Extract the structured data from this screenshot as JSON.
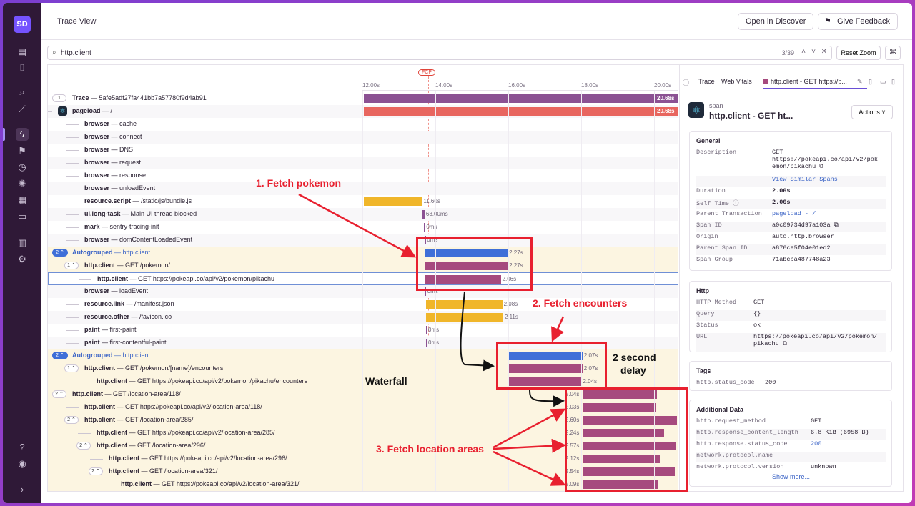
{
  "sidebar": {
    "avatar": "SD"
  },
  "header": {
    "title": "Trace View",
    "open_discover": "Open in Discover",
    "give_feedback": "Give Feedback"
  },
  "search": {
    "value": "http.client",
    "count": "3/39",
    "reset_zoom": "Reset Zoom",
    "shortcut": "⌘"
  },
  "timeline": {
    "ticks": [
      "12.00s",
      "14.00s",
      "16.00s",
      "18.00s",
      "20.00s"
    ],
    "fcp": "FCP"
  },
  "colors": {
    "purple": "#8b5193",
    "red": "#e8665f",
    "yellow": "#f0b62a",
    "blue": "#3f6fd8",
    "magenta": "#a64a7e",
    "annotation": "#e8202f"
  },
  "rows": [
    {
      "indent": 0,
      "badge": "1",
      "op": "Trace",
      "desc": "5afe5adf27fa441bb7a57780f9d4ab91",
      "bar": [
        0.0,
        1.0
      ],
      "color": "purple",
      "dur": "20.68s"
    },
    {
      "indent": 0,
      "icon": true,
      "op": "pageload",
      "desc": "/",
      "bar": [
        0.0,
        1.0
      ],
      "color": "red",
      "dur": "20.68s"
    },
    {
      "indent": 1,
      "op": "browser",
      "desc": "cache"
    },
    {
      "indent": 1,
      "op": "browser",
      "desc": "connect"
    },
    {
      "indent": 1,
      "op": "browser",
      "desc": "DNS"
    },
    {
      "indent": 1,
      "op": "browser",
      "desc": "request"
    },
    {
      "indent": 1,
      "op": "browser",
      "desc": "response"
    },
    {
      "indent": 1,
      "op": "browser",
      "desc": "unloadEvent"
    },
    {
      "indent": 1,
      "op": "resource.script",
      "desc": "/static/js/bundle.js",
      "bar": [
        0.0,
        0.185
      ],
      "color": "yellow",
      "dur": "11.60s"
    },
    {
      "indent": 1,
      "op": "ui.long-task",
      "desc": "Main UI thread blocked",
      "bar": [
        0.186,
        0.193
      ],
      "color": "purple",
      "dur": "63.00ms"
    },
    {
      "indent": 1,
      "op": "mark",
      "desc": "sentry-tracing-init",
      "bar": [
        0.192,
        0.194
      ],
      "color": "purple",
      "dur": "0ms"
    },
    {
      "indent": 1,
      "op": "browser",
      "desc": "domContentLoadedEvent",
      "bar": [
        0.194,
        0.196
      ],
      "color": "purple",
      "dur": "0ms"
    },
    {
      "indent": 0,
      "badge": "2",
      "badgeBlue": true,
      "group": true,
      "autogroup": true,
      "op": "Autogrouped",
      "desc": "http.client",
      "bar": [
        0.194,
        0.457
      ],
      "color": "blue",
      "dur": "2.27s"
    },
    {
      "indent": 1,
      "badge": "1",
      "group": true,
      "op": "http.client",
      "desc": "GET /pokemon/",
      "bar": [
        0.194,
        0.457
      ],
      "color": "magenta",
      "dur": "2.27s"
    },
    {
      "indent": 2,
      "group": true,
      "selected": true,
      "op": "http.client",
      "desc": "GET https://pokeapi.co/api/v2/pokemon/pikachu",
      "bar": [
        0.194,
        0.433
      ],
      "color": "magenta",
      "dur": "2.06s"
    },
    {
      "indent": 1,
      "op": "browser",
      "desc": "loadEvent",
      "bar": [
        0.194,
        0.197
      ],
      "color": "purple",
      "dur": "0ms"
    },
    {
      "indent": 1,
      "op": "resource.link",
      "desc": "/manifest.json",
      "bar": [
        0.197,
        0.44
      ],
      "color": "yellow",
      "dur": "2.08s"
    },
    {
      "indent": 1,
      "op": "resource.other",
      "desc": "/favicon.ico",
      "bar": [
        0.197,
        0.443
      ],
      "color": "yellow",
      "dur": "2.11s"
    },
    {
      "indent": 1,
      "op": "paint",
      "desc": "first-paint",
      "bar": [
        0.198,
        0.2
      ],
      "color": "purple",
      "dur": "0ms"
    },
    {
      "indent": 1,
      "op": "paint",
      "desc": "first-contentful-paint",
      "bar": [
        0.198,
        0.2
      ],
      "color": "purple",
      "dur": "0ms"
    },
    {
      "indent": 0,
      "badge": "2",
      "badgeBlue": true,
      "group": true,
      "autogroup": true,
      "op": "Autogrouped",
      "desc": "http.client",
      "bar": [
        0.457,
        0.695
      ],
      "color": "blue",
      "dur": "2.07s"
    },
    {
      "indent": 1,
      "badge": "1",
      "group": true,
      "op": "http.client",
      "desc": "GET /pokemon/[name]/encounters",
      "bar": [
        0.457,
        0.695
      ],
      "color": "magenta",
      "dur": "2.07s"
    },
    {
      "indent": 2,
      "group": true,
      "op": "http.client",
      "desc": "GET https://pokeapi.co/api/v2/pokemon/pikachu/encounters",
      "bar": [
        0.457,
        0.692
      ],
      "color": "magenta",
      "dur": "2.04s"
    },
    {
      "indent": 0,
      "badge": "2",
      "group": true,
      "op": "http.client",
      "desc": "GET /location-area/118/",
      "bar": [
        0.695,
        0.932
      ],
      "color": "magenta",
      "dur": "2.04s",
      "durLeft": true
    },
    {
      "indent": 1,
      "group": true,
      "op": "http.client",
      "desc": "GET https://pokeapi.co/api/v2/location-area/118/",
      "bar": [
        0.695,
        0.93
      ],
      "color": "magenta",
      "dur": "2.03s",
      "durLeft": true
    },
    {
      "indent": 1,
      "badge": "2",
      "group": true,
      "op": "http.client",
      "desc": "GET /location-area/285/",
      "bar": [
        0.695,
        0.995
      ],
      "color": "magenta",
      "dur": "2.60s",
      "durLeft": true
    },
    {
      "indent": 2,
      "group": true,
      "op": "http.client",
      "desc": "GET https://pokeapi.co/api/v2/location-area/285/",
      "bar": [
        0.695,
        0.955
      ],
      "color": "magenta",
      "dur": "2.24s",
      "durLeft": true
    },
    {
      "indent": 2,
      "badge": "2",
      "group": true,
      "op": "http.client",
      "desc": "GET /location-area/296/",
      "bar": [
        0.695,
        0.99
      ],
      "color": "magenta",
      "dur": "2.57s",
      "durLeft": true
    },
    {
      "indent": 3,
      "group": true,
      "op": "http.client",
      "desc": "GET https://pokeapi.co/api/v2/location-area/296/",
      "bar": [
        0.695,
        0.94
      ],
      "color": "magenta",
      "dur": "2.12s",
      "durLeft": true
    },
    {
      "indent": 3,
      "badge": "2",
      "group": true,
      "op": "http.client",
      "desc": "GET /location-area/321/",
      "bar": [
        0.695,
        0.988
      ],
      "color": "magenta",
      "dur": "2.54s",
      "durLeft": true
    },
    {
      "indent": 4,
      "group": true,
      "op": "http.client",
      "desc": "GET https://pokeapi.co/api/v2/location-area/321/",
      "bar": [
        0.695,
        0.936
      ],
      "color": "magenta",
      "dur": "2.09s",
      "durLeft": true
    }
  ],
  "panel": {
    "tab_trace": "Trace",
    "tab_vitals": "Web Vitals",
    "tab_span": "http.client - GET https://p...",
    "span_type": "span",
    "span_title": "http.client - GET ht...",
    "actions": "Actions",
    "general_title": "General",
    "general": [
      {
        "k": "Description",
        "v": "GET\nhttps://pokeapi.co/api/v2/pok\nemon/pikachu ⧉"
      },
      {
        "k": "",
        "v": "View Similar Spans",
        "link": true
      },
      {
        "k": "Duration",
        "v": "2.06s",
        "bold": true
      },
      {
        "k": "Self Time ⓘ",
        "v": "2.06s",
        "bold": true
      },
      {
        "k": "Parent Transaction",
        "v": "pageload - /",
        "link": true
      },
      {
        "k": "Span ID",
        "v": "a0c09734d97a103a ⧉"
      },
      {
        "k": "Origin",
        "v": "auto.http.browser"
      },
      {
        "k": "Parent Span ID",
        "v": "a876ce5f04e01ed2"
      },
      {
        "k": "Span Group",
        "v": "71abcba487748a23"
      }
    ],
    "http_title": "Http",
    "http": [
      {
        "k": "HTTP Method",
        "v": "GET"
      },
      {
        "k": "Query",
        "v": "{}"
      },
      {
        "k": "Status",
        "v": "ok"
      },
      {
        "k": "URL",
        "v": "https://pokeapi.co/api/v2/pokemon/\npikachu ⧉"
      }
    ],
    "tags_title": "Tags",
    "tags": [
      {
        "k": "http.status_code",
        "v": "200"
      }
    ],
    "additional_title": "Additional Data",
    "additional": [
      {
        "k": "http.request_method",
        "v": "GET"
      },
      {
        "k": "http.response_content_length",
        "v": "6.8 KiB (6958 B)"
      },
      {
        "k": "http.response.status_code",
        "v": "200",
        "link": true
      },
      {
        "k": "network.protocol.name",
        "v": ""
      },
      {
        "k": "network.protocol.version",
        "v": "unknown"
      }
    ],
    "show_more": "Show more..."
  },
  "annotations": {
    "fetch_pokemon": "1. Fetch pokemon",
    "fetch_encounters": "2. Fetch encounters",
    "delay_1": "2 second",
    "delay_2": "delay",
    "waterfall": "Waterfall",
    "fetch_locations": "3. Fetch location areas"
  }
}
